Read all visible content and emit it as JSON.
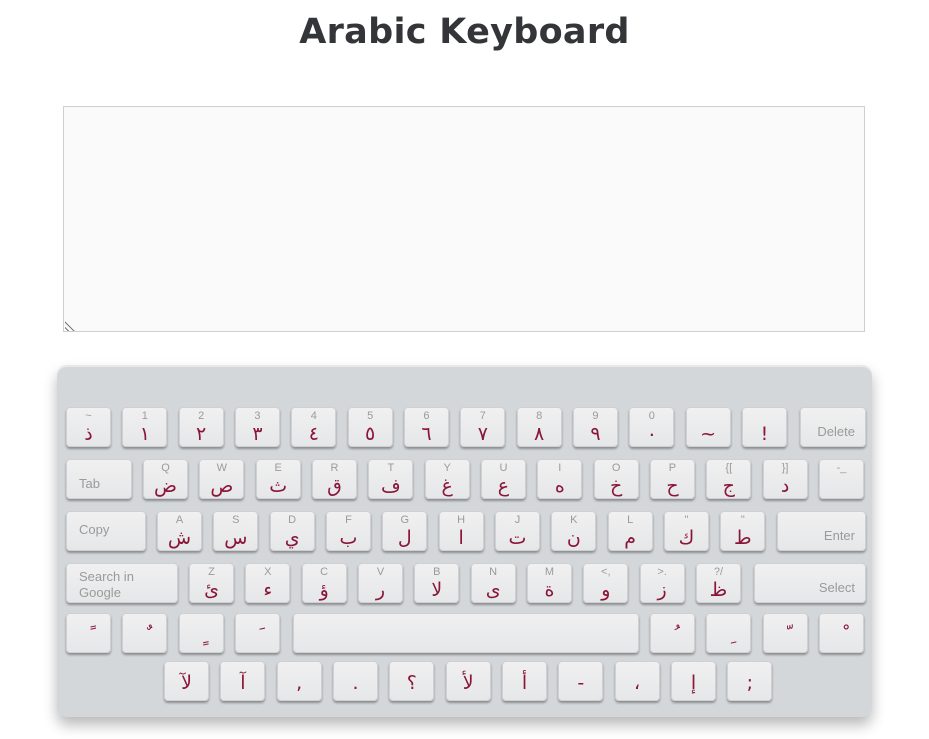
{
  "page": {
    "title": "Arabic Keyboard"
  },
  "keys": {
    "r1": [
      {
        "sec": "~",
        "main": "ذ"
      },
      {
        "sec": "1",
        "main": "١"
      },
      {
        "sec": "2",
        "main": "٢"
      },
      {
        "sec": "3",
        "main": "٣"
      },
      {
        "sec": "4",
        "main": "٤"
      },
      {
        "sec": "5",
        "main": "٥"
      },
      {
        "sec": "6",
        "main": "٦"
      },
      {
        "sec": "7",
        "main": "٧"
      },
      {
        "sec": "8",
        "main": "٨"
      },
      {
        "sec": "9",
        "main": "٩"
      },
      {
        "sec": "0",
        "main": "٠"
      },
      {
        "sec": "",
        "main": "~"
      },
      {
        "sec": "",
        "main": "!"
      }
    ],
    "delete": "Delete",
    "tab": "Tab",
    "r2": [
      {
        "sec": "Q",
        "main": "ض"
      },
      {
        "sec": "W",
        "main": "ص"
      },
      {
        "sec": "E",
        "main": "ث"
      },
      {
        "sec": "R",
        "main": "ق"
      },
      {
        "sec": "T",
        "main": "ف"
      },
      {
        "sec": "Y",
        "main": "غ"
      },
      {
        "sec": "U",
        "main": "ع"
      },
      {
        "sec": "I",
        "main": "ه"
      },
      {
        "sec": "O",
        "main": "خ"
      },
      {
        "sec": "P",
        "main": "ح"
      },
      {
        "sec": "{[",
        "main": "ج"
      },
      {
        "sec": "}]",
        "main": "د"
      },
      {
        "sec": "-_",
        "main": ""
      }
    ],
    "copy": "Copy",
    "r3": [
      {
        "sec": "A",
        "main": "ش"
      },
      {
        "sec": "S",
        "main": "س"
      },
      {
        "sec": "D",
        "main": "ي"
      },
      {
        "sec": "F",
        "main": "ب"
      },
      {
        "sec": "G",
        "main": "ل"
      },
      {
        "sec": "H",
        "main": "ا"
      },
      {
        "sec": "J",
        "main": "ت"
      },
      {
        "sec": "K",
        "main": "ن"
      },
      {
        "sec": "L",
        "main": "م"
      },
      {
        "sec": "\"",
        "main": "ك"
      },
      {
        "sec": "\"",
        "main": "ط"
      }
    ],
    "enter": "Enter",
    "search_line1": "Search in",
    "search_line2": "Google",
    "r4": [
      {
        "sec": "Z",
        "main": "ئ"
      },
      {
        "sec": "X",
        "main": "ء"
      },
      {
        "sec": "C",
        "main": "ؤ"
      },
      {
        "sec": "V",
        "main": "ر"
      },
      {
        "sec": "B",
        "main": "لا"
      },
      {
        "sec": "N",
        "main": "ى"
      },
      {
        "sec": "M",
        "main": "ة"
      },
      {
        "sec": "<,",
        "main": "و"
      },
      {
        "sec": ">.",
        "main": "ز"
      },
      {
        "sec": "?/",
        "main": "ظ"
      }
    ],
    "select": "Select",
    "r5_left": [
      {
        "main": "ً"
      },
      {
        "main": "ٌ"
      },
      {
        "main": "ٍ"
      },
      {
        "main": "َ"
      }
    ],
    "r5_right": [
      {
        "main": "ُ"
      },
      {
        "main": "ِ"
      },
      {
        "main": "ّ"
      },
      {
        "main": "ْ"
      }
    ],
    "r6": [
      {
        "main": "لآ"
      },
      {
        "main": "آ"
      },
      {
        "main": ","
      },
      {
        "main": "."
      },
      {
        "main": "؟"
      },
      {
        "main": "لأ"
      },
      {
        "main": "أ"
      },
      {
        "main": "-"
      },
      {
        "main": "،"
      },
      {
        "main": "إ"
      },
      {
        "main": ";"
      }
    ]
  }
}
